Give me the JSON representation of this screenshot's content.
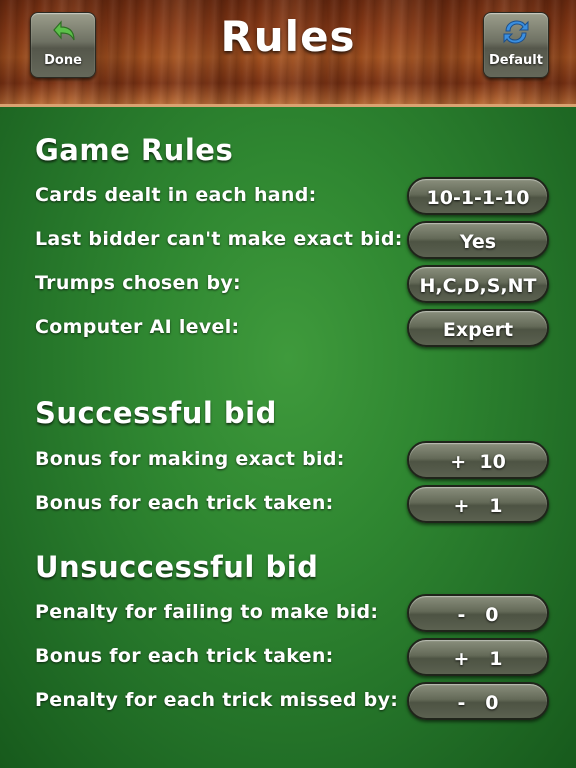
{
  "header": {
    "title": "Rules",
    "done_label": "Done",
    "default_label": "Default"
  },
  "colors": {
    "felt_green": "#2f8731",
    "button_gray": "#646a58",
    "done_arrow_green": "#5cc04a",
    "refresh_blue": "#3a8fe0"
  },
  "sections": {
    "game_rules": {
      "title": "Game Rules",
      "rows": [
        {
          "label": "Cards dealt in each hand:",
          "value": "10-1-1-10"
        },
        {
          "label": "Last bidder can't make exact bid:",
          "value": "Yes"
        },
        {
          "label": "Trumps chosen by:",
          "value": "H,C,D,S,NT"
        },
        {
          "label": "Computer AI level:",
          "value": "Expert"
        }
      ]
    },
    "successful_bid": {
      "title": "Successful bid",
      "rows": [
        {
          "label": "Bonus for making exact bid:",
          "value": "+  10"
        },
        {
          "label": "Bonus for each trick taken:",
          "value": "+   1"
        }
      ]
    },
    "unsuccessful_bid": {
      "title": "Unsuccessful bid",
      "rows": [
        {
          "label": "Penalty for failing to make bid:",
          "value": "-   0"
        },
        {
          "label": "Bonus for each trick taken:",
          "value": "+   1"
        },
        {
          "label": "Penalty for each trick missed by:",
          "value": "-   0"
        }
      ]
    }
  }
}
